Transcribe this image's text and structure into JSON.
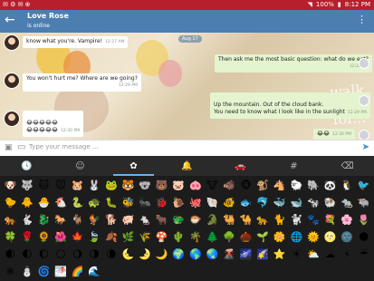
{
  "status_bar": {
    "left_icons": "✉ ⚙ ✉ ⊕",
    "battery": "100%",
    "time": "8:12 PM"
  },
  "header": {
    "title": "Love Rose",
    "subtitle": "is online"
  },
  "date_chip": "Aug 17",
  "messages": [
    {
      "side": "in",
      "text": "know what you're. Vampire!",
      "time": "12:27 AM",
      "has_avatar": true
    },
    {
      "side": "out",
      "text": "Then ask me the most basic question: what do we eat?",
      "time": "12:28 PM"
    },
    {
      "side": "in",
      "text": "You won't hurt me? Where are we going?",
      "time": "12:29 PM",
      "has_avatar": true
    },
    {
      "side": "out",
      "text": "Up the mountain. Out of the cloud bank.\nYou need to know what I look like in the sunlight",
      "time": "12:29 PM"
    },
    {
      "side": "in",
      "text": "😂😂😂😂😂\n😂😂😂😂😂",
      "time": "12:30 PM",
      "has_avatar": true
    },
    {
      "side": "out",
      "text": "😂😂",
      "time": "12:30 PM"
    }
  ],
  "watermark": "walk\nwith me\nfor...",
  "input": {
    "placeholder": "Type your message ..."
  },
  "emoji_tabs": [
    {
      "icon": "🕓",
      "name": "recent-tab"
    },
    {
      "icon": "☺",
      "name": "smileys-tab"
    },
    {
      "icon": "✿",
      "name": "nature-tab",
      "active": true
    },
    {
      "icon": "🔔",
      "name": "objects-tab"
    },
    {
      "icon": "🚗",
      "name": "places-tab"
    },
    {
      "icon": "#",
      "name": "symbols-tab"
    },
    {
      "icon": "⌫",
      "name": "backspace"
    }
  ],
  "emoji_rows": [
    [
      "🐶",
      "🐺",
      "🐱",
      "🐭",
      "🐹",
      "🐰",
      "🐸",
      "🐯",
      "🐨",
      "🐻",
      "🐷",
      "🐽",
      "🐮",
      "🐗",
      "🐵",
      "🐒",
      "🐴",
      "🐑",
      "🐘",
      "🐼",
      "🐧",
      "🐦"
    ],
    [
      "🐤",
      "🐥",
      "🐣",
      "🐔",
      "🐍",
      "🐢",
      "🐛",
      "🐝",
      "🐜",
      "🐞",
      "🐌",
      "🐙",
      "🐚",
      "🐠",
      "🐟",
      "🐬",
      "🐳",
      "🐋",
      "🐄",
      "🐏",
      "🐀",
      "🐃"
    ],
    [
      "🐅",
      "🐇",
      "🐉",
      "🐎",
      "🐐",
      "🐓",
      "🐕",
      "🐖",
      "🐁",
      "🐂",
      "🐲",
      "🐡",
      "🐊",
      "🐫",
      "🐪",
      "🐆",
      "🐈",
      "🐩",
      "🐾",
      "💐",
      "🌸",
      "🌷"
    ],
    [
      "🍀",
      "🌹",
      "🌻",
      "🌺",
      "🍁",
      "🍃",
      "🍂",
      "🌿",
      "🌾",
      "🍄",
      "🌵",
      "🌴",
      "🌲",
      "🌳",
      "🌰",
      "🌱",
      "🌼",
      "🌐",
      "🌞",
      "🌝",
      "🌚",
      "🌑"
    ],
    [
      "🌒",
      "🌓",
      "🌔",
      "🌕",
      "🌖",
      "🌗",
      "🌘",
      "🌜",
      "🌛",
      "🌙",
      "🌍",
      "🌎",
      "🌏",
      "🌋",
      "🌌",
      "🌠",
      "⭐",
      "☀",
      "⛅",
      "☁",
      "⚡",
      "☔"
    ],
    [
      "❄",
      "⛄",
      "🌀",
      "🌁",
      "🌈",
      "🌊"
    ]
  ],
  "colors": {
    "status_bar": "#b71f2c",
    "app_bar": "#4c7fb0",
    "accent": "#6bb0ea",
    "keyboard": "#1c1c1c"
  }
}
